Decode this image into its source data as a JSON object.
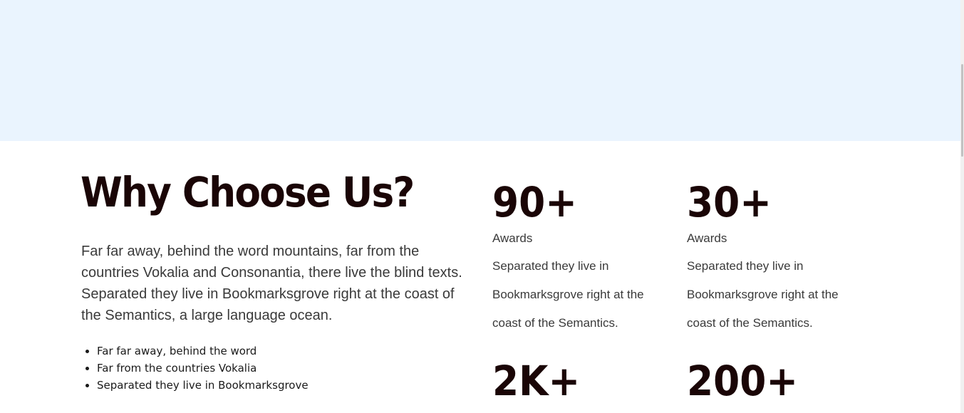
{
  "why": {
    "title": "Why Choose Us?",
    "paragraph": "Far far away, behind the word mountains, far from the countries Vokalia and Consonantia, there live the blind texts. Separated they live in Bookmarksgrove right at the coast of the Semantics, a large language ocean.",
    "bullets": [
      "Far far away, behind the word",
      "Far from the countries Vokalia",
      "Separated they live in Bookmarksgrove"
    ]
  },
  "stats": [
    {
      "number": "90+",
      "label": "Awards",
      "description": "Separated they live in Bookmarksgrove right at the coast of the Semantics."
    },
    {
      "number": "30+",
      "label": "Awards",
      "description": "Separated they live in Bookmarksgrove right at the coast of the Semantics."
    },
    {
      "number": "2K+"
    },
    {
      "number": "200+"
    }
  ],
  "colors": {
    "hero_background": "#eaf4fe",
    "heading": "#1a0506",
    "body_text": "#3a3a3a"
  }
}
